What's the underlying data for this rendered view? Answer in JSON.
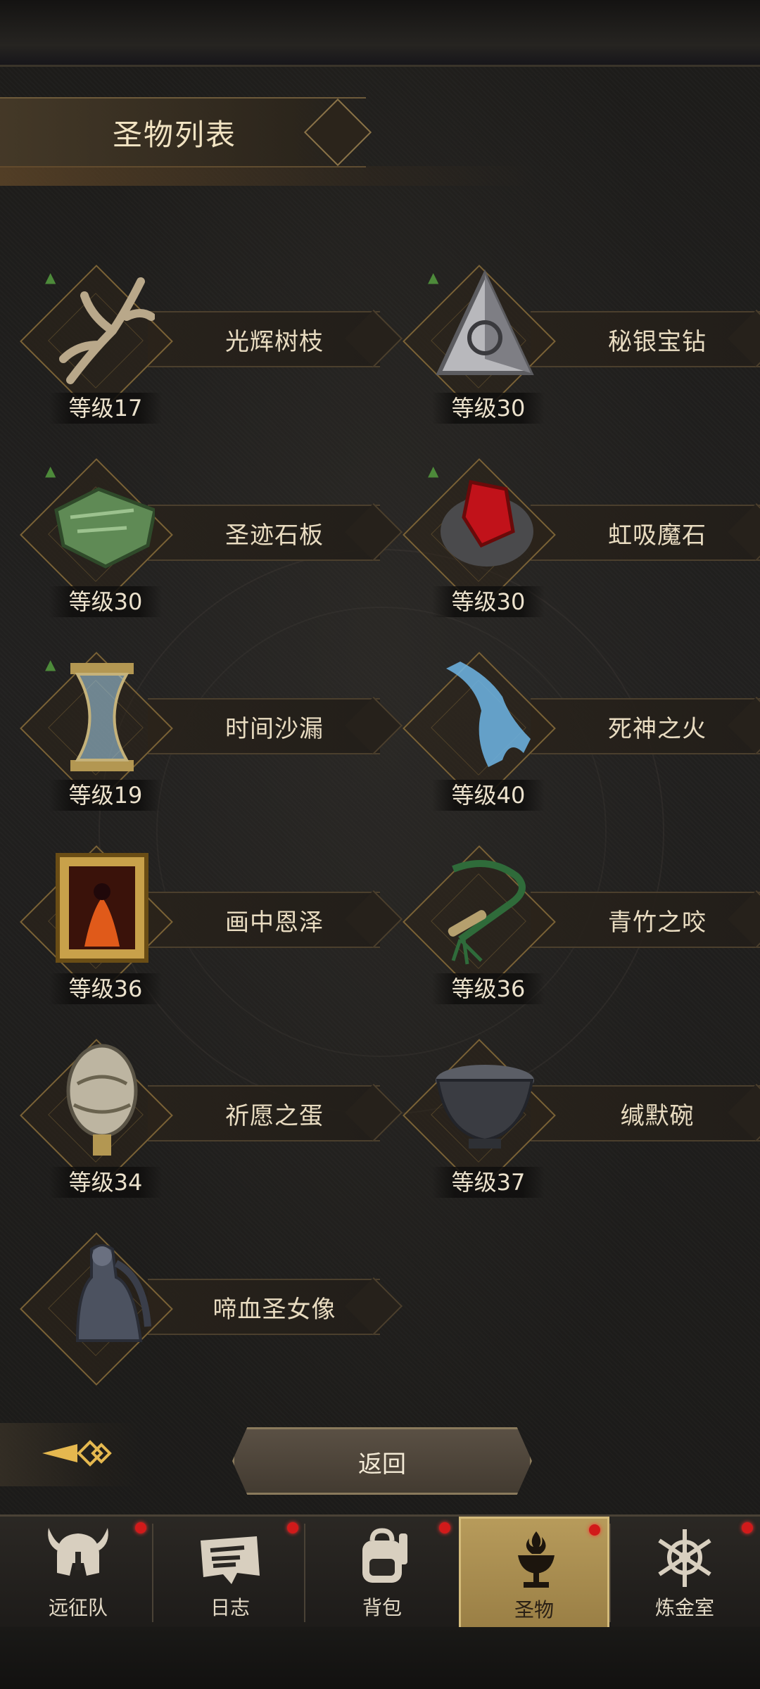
{
  "title": "圣物列表",
  "relics": [
    {
      "name": "光辉树枝",
      "level": "等级17",
      "upgradable": true,
      "icon": "branch-icon"
    },
    {
      "name": "秘银宝钻",
      "level": "等级30",
      "upgradable": true,
      "icon": "mithril-pyramid-icon"
    },
    {
      "name": "圣迹石板",
      "level": "等级30",
      "upgradable": true,
      "icon": "stone-tablet-icon"
    },
    {
      "name": "虹吸魔石",
      "level": "等级30",
      "upgradable": true,
      "icon": "red-gem-icon"
    },
    {
      "name": "时间沙漏",
      "level": "等级19",
      "upgradable": true,
      "icon": "hourglass-icon"
    },
    {
      "name": "死神之火",
      "level": "等级40",
      "upgradable": false,
      "icon": "spectral-hand-icon"
    },
    {
      "name": "画中恩泽",
      "level": "等级36",
      "upgradable": false,
      "icon": "demon-painting-icon"
    },
    {
      "name": "青竹之咬",
      "level": "等级36",
      "upgradable": false,
      "icon": "green-whip-icon"
    },
    {
      "name": "祈愿之蛋",
      "level": "等级34",
      "upgradable": false,
      "icon": "ornate-egg-icon"
    },
    {
      "name": "缄默碗",
      "level": "等级37",
      "upgradable": false,
      "icon": "dark-bowl-icon"
    },
    {
      "name": "啼血圣女像",
      "level": "",
      "upgradable": false,
      "icon": "angel-statue-icon"
    }
  ],
  "back_button": "返回",
  "tabs": [
    {
      "label": "远征队",
      "icon": "helmet-icon",
      "badge": true,
      "active": false
    },
    {
      "label": "日志",
      "icon": "scroll-icon",
      "badge": true,
      "active": false
    },
    {
      "label": "背包",
      "icon": "backpack-icon",
      "badge": true,
      "active": false
    },
    {
      "label": "圣物",
      "icon": "chalice-icon",
      "badge": true,
      "active": true
    },
    {
      "label": "炼金室",
      "icon": "alchemy-icon",
      "badge": true,
      "active": false
    }
  ],
  "colors": {
    "accent_gold": "#b79b5b",
    "badge_red": "#d11a1a",
    "level_up_green": "#4d8a3a"
  }
}
